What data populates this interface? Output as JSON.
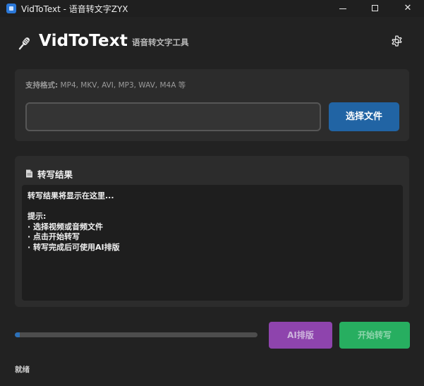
{
  "window": {
    "title": "VidToText - 语音转文字ZYX",
    "close_glyph": "✕"
  },
  "header": {
    "title": "VidToText",
    "subtitle": "语音转文字工具",
    "icon": "microphone-icon",
    "settings_icon": "gear-icon"
  },
  "file_panel": {
    "formats_label": "支持格式:",
    "formats_list": "MP4, MKV, AVI, MP3, WAV, M4A 等",
    "file_path_value": "",
    "choose_button": "选择文件"
  },
  "results": {
    "icon": "document-icon",
    "title": "转写结果",
    "text": "转写结果将显示在这里...\n\n提示:\n· 选择视频或音频文件\n· 点击开始转写\n· 转写完成后可使用AI排版"
  },
  "footer": {
    "progress": 0.02,
    "ai_button": "AI排版",
    "start_button": "开始转写",
    "status": "就绪"
  },
  "colors": {
    "background": "#222222",
    "panel": "#2c2c2c",
    "choose_button": "#2164a4",
    "ai_button": "#8e44ad",
    "start_button": "#27ae60",
    "progress_fill": "#2c70b8"
  }
}
